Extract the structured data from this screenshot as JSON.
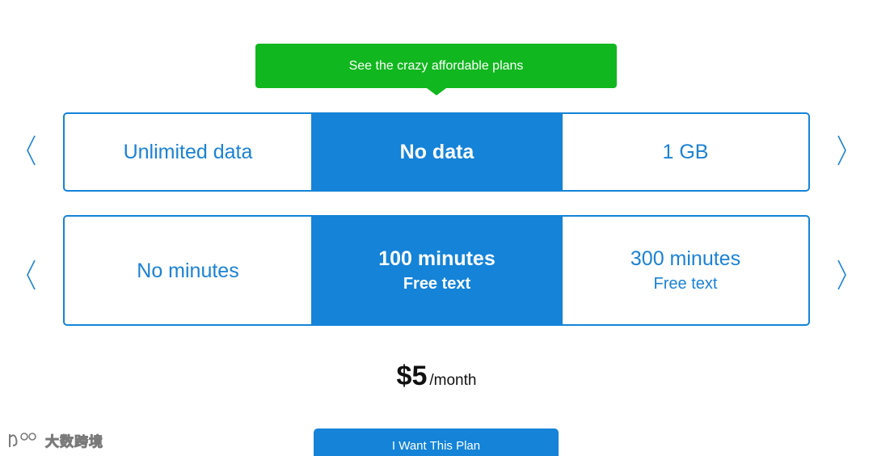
{
  "banner": {
    "text": "See the crazy affordable plans"
  },
  "data_selector": {
    "options": [
      {
        "label": "Unlimited data"
      },
      {
        "label": "No data"
      },
      {
        "label": "1 GB"
      }
    ],
    "selected_index": 1
  },
  "minutes_selector": {
    "options": [
      {
        "label": "No minutes",
        "sub": ""
      },
      {
        "label": "100 minutes",
        "sub": "Free text"
      },
      {
        "label": "300 minutes",
        "sub": "Free text"
      }
    ],
    "selected_index": 1
  },
  "price": {
    "amount": "$5",
    "period": "/month"
  },
  "cta": {
    "label": "I Want This Plan"
  },
  "watermark": {
    "text": "大数跨境"
  },
  "colors": {
    "accent": "#1483d8",
    "banner": "#10b71e",
    "text_blue": "#1b82d4"
  },
  "icons": {
    "prev": "chevron-left-icon",
    "next": "chevron-right-icon"
  }
}
